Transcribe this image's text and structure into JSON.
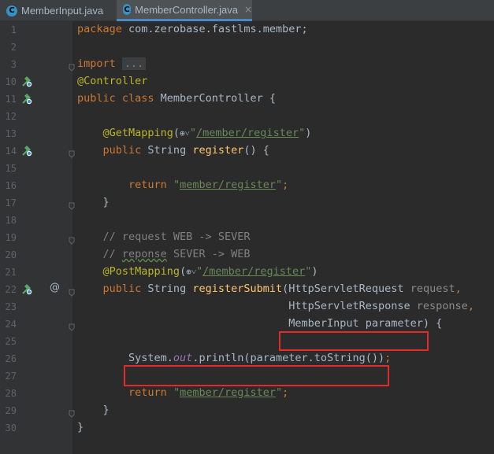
{
  "tabs": [
    {
      "label": "MemberInput.java",
      "icon": "C",
      "active": false
    },
    {
      "label": "MemberController.java",
      "icon": "C",
      "active": true,
      "close": "×"
    }
  ],
  "lines": [
    {
      "n": "1",
      "html": "<span class='kw'>package</span> com.zerobase.fastlms.member;"
    },
    {
      "n": "2",
      "html": ""
    },
    {
      "n": "3",
      "html": "<span class='kw'>import</span> <span class='dots'>...</span>"
    },
    {
      "n": "10",
      "html": "<span class='ann'>@Controller</span>"
    },
    {
      "n": "11",
      "html": "<span class='kw'>public class</span> MemberController {"
    },
    {
      "n": "12",
      "html": ""
    },
    {
      "n": "13",
      "html": "    <span class='ann'>@GetMapping</span>(<span class='globe'>⊕˅</span><span class='str'>\"<span class='u'>/member/register</span>\"</span>)"
    },
    {
      "n": "14",
      "html": "    <span class='kw'>public</span> String <span class='method'>register</span>() {"
    },
    {
      "n": "15",
      "html": ""
    },
    {
      "n": "16",
      "html": "        <span class='kw'>return</span> <span class='str'>\"<span class='u'>member/register</span>\"</span><span class='kw'>;</span>"
    },
    {
      "n": "17",
      "html": "    }"
    },
    {
      "n": "18",
      "html": ""
    },
    {
      "n": "19",
      "html": "    <span class='cmt'>// request WEB -&gt; SEVER</span>"
    },
    {
      "n": "20",
      "html": "    <span class='cmt'>// <span class='wavy'>reponse</span> SEVER -&gt; WEB</span>"
    },
    {
      "n": "21",
      "html": "    <span class='ann'>@PostMapping</span>(<span class='globe'>⊕˅</span><span class='str'>\"<span class='u'>/member/register</span>\"</span>)"
    },
    {
      "n": "22",
      "html": "    <span class='kw'>public</span> String <span class='method'>registerSubmit</span>(HttpServletRequest <span class='param'>request</span><span class='kw'>,</span>"
    },
    {
      "n": "23",
      "html": "                                 HttpServletResponse <span class='param'>response</span><span class='kw'>,</span>"
    },
    {
      "n": "24",
      "html": "                                 MemberInput parameter) {"
    },
    {
      "n": "25",
      "html": ""
    },
    {
      "n": "26",
      "html": "        System.<span class='static'>out</span>.println(parameter.toString())<span class='kw'>;</span>"
    },
    {
      "n": "27",
      "html": ""
    },
    {
      "n": "28",
      "html": "        <span class='kw'>return</span> <span class='str'>\"<span class='u'>member/register</span>\"</span><span class='kw'>;</span>"
    },
    {
      "n": "29",
      "html": "    }"
    },
    {
      "n": "30",
      "html": "}"
    }
  ],
  "gutter_marks": {
    "10": "bean-icon",
    "11": "bean-icon",
    "14": "bean-icon",
    "22": "bean-icon"
  },
  "at_mark": {
    "line": "22",
    "symbol": "@"
  },
  "colors": {
    "highlight_box": "#e22a2a",
    "accent": "#4a88c7"
  }
}
